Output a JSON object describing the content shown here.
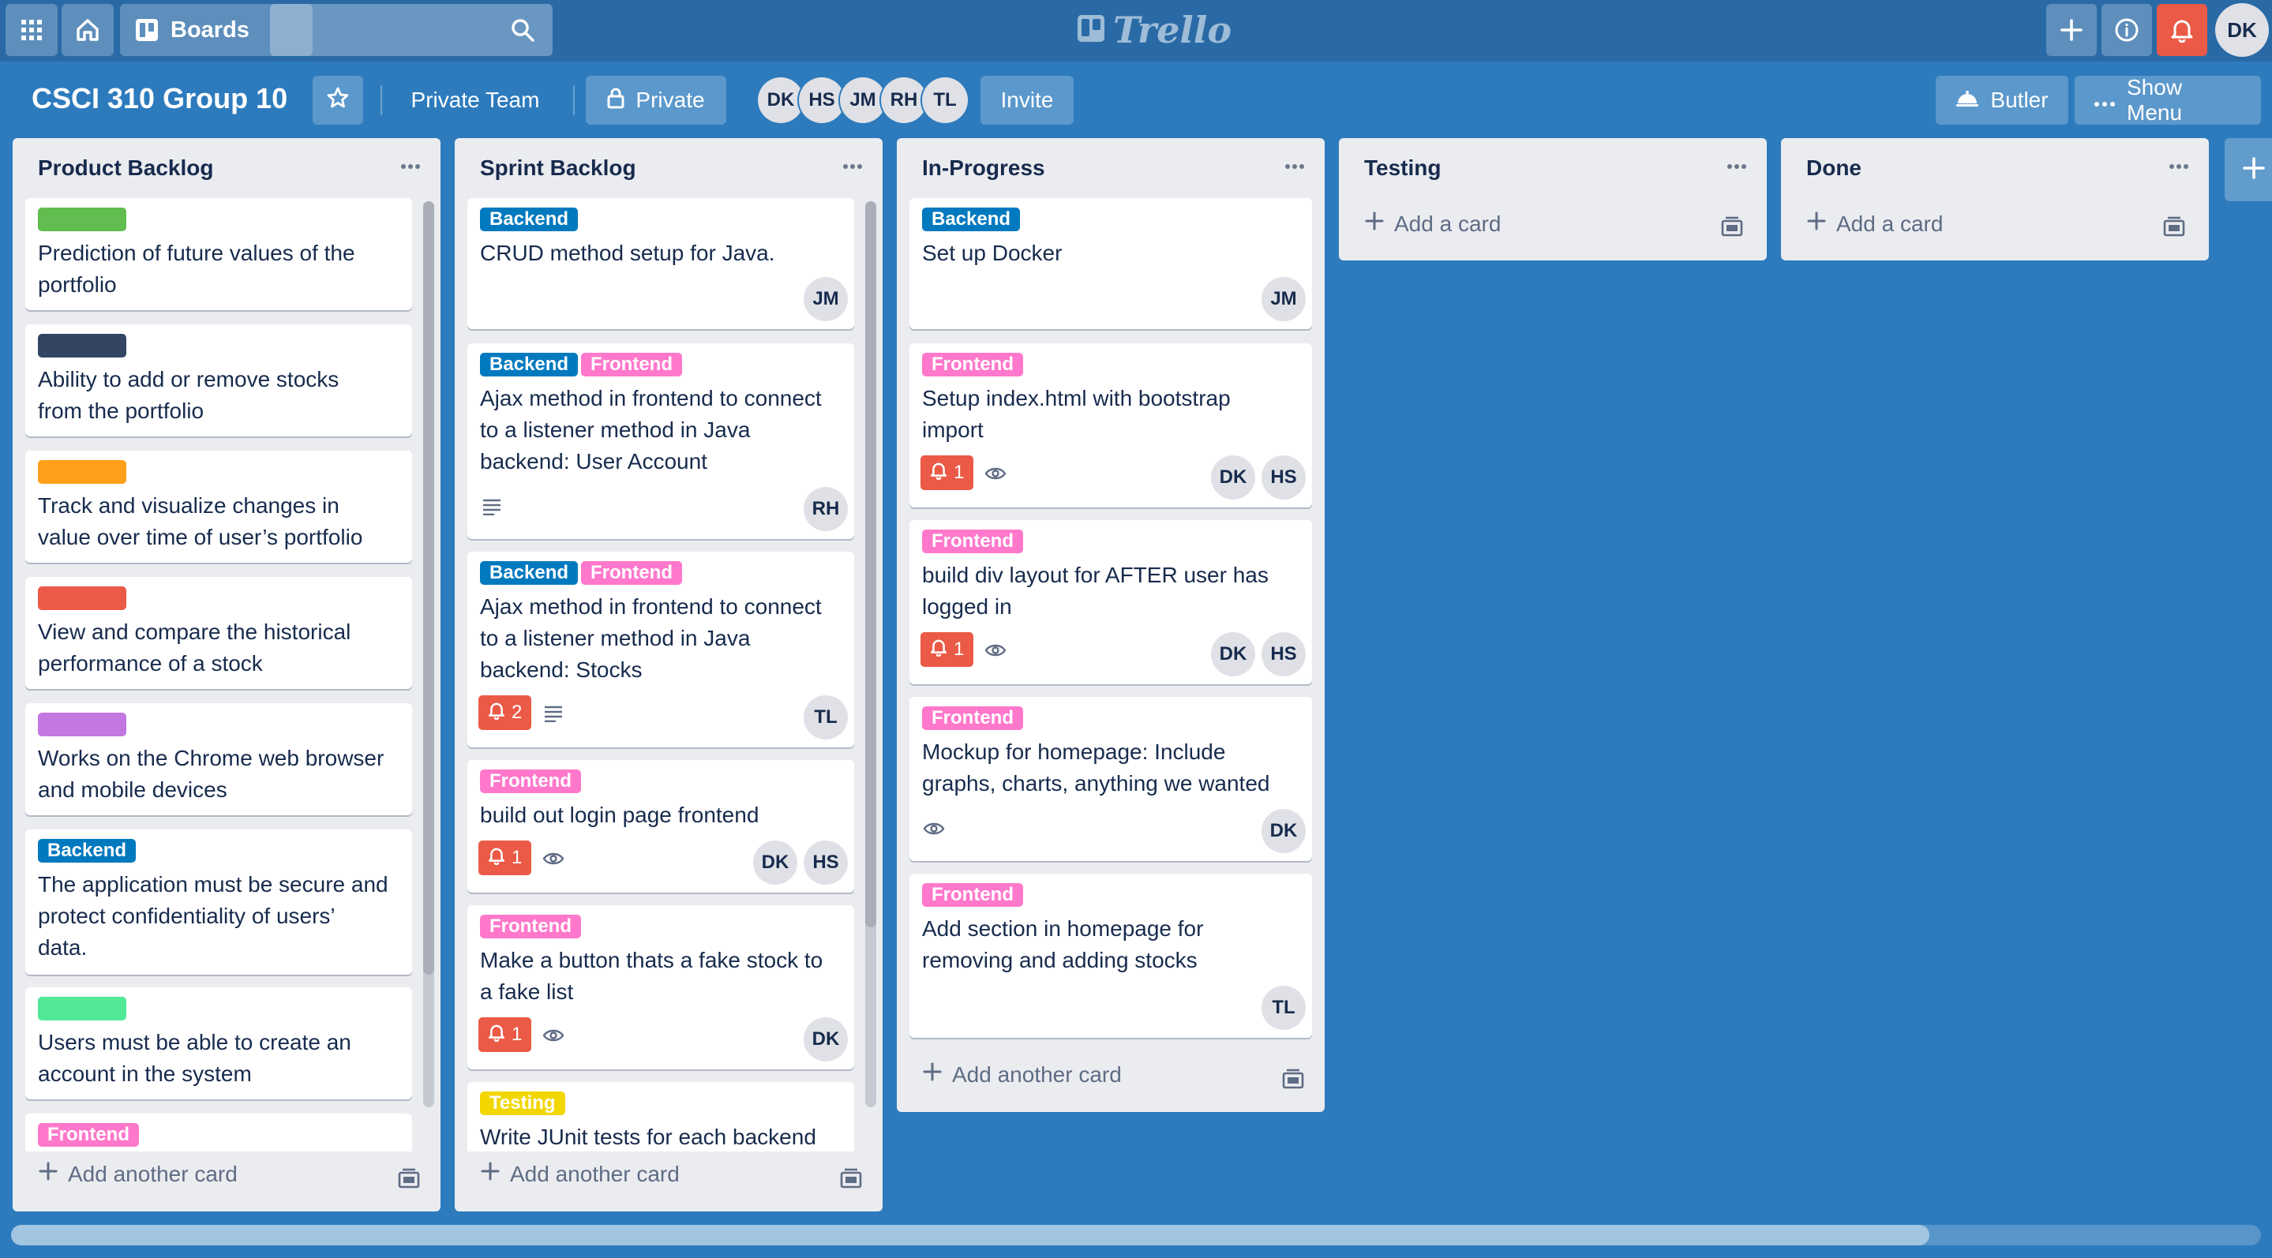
{
  "topbar": {
    "boards_label": "Boards",
    "logo_text": "Trello",
    "user_initials": "DK"
  },
  "board": {
    "title": "CSCI 310 Group 10",
    "team": "Private Team",
    "visibility": "Private",
    "members": [
      "DK",
      "HS",
      "JM",
      "RH",
      "TL"
    ],
    "invite_label": "Invite",
    "butler_label": "Butler",
    "menu_label": "Show Menu"
  },
  "colors": {
    "green": "#61bd4f",
    "navy": "#344563",
    "orange": "#ff9f1a",
    "red": "#eb5a46",
    "purple": "#c377e0",
    "blue": "#0079bf",
    "lime": "#51e898",
    "pink": "#ff78cb",
    "yellow": "#f2d600"
  },
  "lists": {
    "product_backlog": {
      "name": "Product Backlog",
      "add_label": "Add another card",
      "cards": [
        {
          "text_lines": [
            "Prediction of future values of the",
            "portfolio"
          ]
        },
        {
          "text_lines": [
            "Ability to add or remove stocks",
            "from the portfolio"
          ]
        },
        {
          "text_lines": [
            "Track and visualize changes in",
            "value over time of user’s portfolio"
          ]
        },
        {
          "text_lines": [
            "View and compare the historical",
            "performance of a stock"
          ]
        },
        {
          "text_lines": [
            "Works on the Chrome web browser",
            "and mobile devices"
          ]
        },
        {
          "label": "Backend",
          "text_lines": [
            "The application must be secure and",
            "protect confidentiality of users’",
            "data."
          ]
        },
        {
          "text_lines": [
            "Users must be able to create an",
            "account in the system"
          ]
        },
        {
          "label": "Frontend"
        }
      ]
    },
    "sprint_backlog": {
      "name": "Sprint Backlog",
      "add_label": "Add another card",
      "cards": [
        {
          "labels": [
            "Backend"
          ],
          "text_lines": [
            "CRUD method setup for Java."
          ],
          "members": [
            "JM"
          ]
        },
        {
          "labels": [
            "Backend",
            "Frontend"
          ],
          "text_lines": [
            "Ajax method in frontend to connect",
            "to a listener method in Java",
            "backend: User Account"
          ],
          "members": [
            "RH"
          ]
        },
        {
          "labels": [
            "Backend",
            "Frontend"
          ],
          "text_lines": [
            "Ajax method in frontend to connect",
            "to a listener method in Java",
            "backend: Stocks"
          ],
          "due_count": "2",
          "members": [
            "TL"
          ]
        },
        {
          "labels": [
            "Frontend"
          ],
          "text_lines": [
            "build out login page frontend"
          ],
          "due_count": "1",
          "members": [
            "DK",
            "HS"
          ]
        },
        {
          "labels": [
            "Frontend"
          ],
          "text_lines": [
            "Make a button thats a fake stock to",
            "a fake list"
          ],
          "due_count": "1",
          "members": [
            "DK"
          ]
        },
        {
          "labels": [
            "Testing"
          ],
          "text_lines": [
            "Write JUnit tests for each backend"
          ]
        }
      ]
    },
    "in_progress": {
      "name": "In-Progress",
      "add_label": "Add another card",
      "cards": [
        {
          "labels": [
            "Backend"
          ],
          "text_lines": [
            "Set up Docker"
          ],
          "members": [
            "JM"
          ]
        },
        {
          "labels": [
            "Frontend"
          ],
          "text_lines": [
            "Setup index.html with bootstrap",
            "import"
          ],
          "due_count": "1",
          "members": [
            "DK",
            "HS"
          ]
        },
        {
          "labels": [
            "Frontend"
          ],
          "text_lines": [
            "build div layout for AFTER user has",
            "logged in"
          ],
          "due_count": "1",
          "members": [
            "DK",
            "HS"
          ]
        },
        {
          "labels": [
            "Frontend"
          ],
          "text_lines": [
            "Mockup for homepage: Include",
            "graphs, charts, anything we wanted"
          ],
          "members": [
            "DK"
          ]
        },
        {
          "labels": [
            "Frontend"
          ],
          "text_lines": [
            "Add section in homepage for",
            "removing and adding stocks"
          ],
          "members": [
            "TL"
          ]
        }
      ]
    },
    "testing": {
      "name": "Testing",
      "add_label": "Add a card"
    },
    "done": {
      "name": "Done",
      "add_label": "Add a card"
    }
  }
}
